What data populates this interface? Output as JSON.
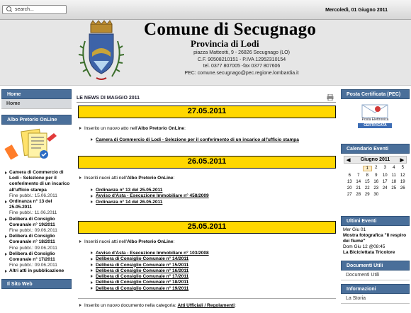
{
  "topbar": {
    "search_placeholder": "search...",
    "date": "Mercoledì, 01 Giugno 2011"
  },
  "header": {
    "title": "Comune di Secugnago",
    "subtitle": "Provincia di Lodi",
    "address": "piazza Matteotti, 9 - 26826 Secugnago (LO)",
    "fiscal": "C.F. 90508210151 - P.IVA 12952310154",
    "phone": "tel. 0377 807005  -fax 0377 807606",
    "pec": "PEC: comune.secugnago@pec.regione.lombardia.it"
  },
  "left": {
    "home_header": "Home",
    "home_item": "Home",
    "albo_header": "Albo Pretorio OnLine",
    "albo_items": [
      {
        "title": "Camera di Commercio di Lodi - Selezione per il conferimento di un incarico all'ufficio stampa",
        "date": "Fine pubbl.: 15.06.2011"
      },
      {
        "title": "Ordinanza n° 13 del 25.05.2011",
        "date": "Fine pubbl.: 11.06.2011"
      },
      {
        "title": "Delibera di Consiglio Comunale n° 19/2011",
        "date": "Fine pubbl.: 09.06.2011"
      },
      {
        "title": "Delibera di Consiglio Comunale n° 18/2011",
        "date": "Fine pubbl.: 09.06.2011"
      },
      {
        "title": "Delibera di Consiglio Comunale n° 17/2011",
        "date": "Fine pubbl.: 09.06.2011"
      },
      {
        "title": "Altri atti in pubblicazione",
        "date": ""
      }
    ],
    "sito_header": "Il Sito Web"
  },
  "main": {
    "title": "LE NEWS DI MAGGIO 2011",
    "days": [
      {
        "date": "27.05.2011",
        "intro_pre": "Inserito un nuovo atto nell'",
        "intro_bold": "Albo Pretorio OnLine",
        "intro_post": ":",
        "links": [
          "Camera di Commercio di Lodi - Selezione per il conferimento di un incarico all'ufficio stampa"
        ]
      },
      {
        "date": "26.05.2011",
        "intro_pre": "Inseriti nuovi atti nell'",
        "intro_bold": "Albo Pretorio OnLine",
        "intro_post": ":",
        "links": [
          "Ordinanza n° 13 del 25.05.2011",
          "Avviso d'Asta - Esecuzione Immobiliare n° 458/2009",
          "Ordinanza n° 14 del 26.05.2011"
        ]
      },
      {
        "date": "25.05.2011",
        "intro_pre": "Inseriti nuovi atti nell'",
        "intro_bold": "Albo Pretorio OnLine",
        "intro_post": ":",
        "links": [
          "Avviso d'Asta - Esecuzione Immobiliare n° 103/2008",
          "Delibera di Consiglio Comunale n° 14/2011",
          "Delibera di Consiglio Comunale n° 15/2011",
          "Delibera di Consiglio Comunale n° 16/2011",
          "Delibera di Consiglio Comunale n° 17/2011",
          "Delibera di Consiglio Comunale n° 18/2011",
          "Delibera di Consiglio Comunale n° 19/2011"
        ]
      }
    ],
    "last_entry_pre": "Inserito un nuovo documento nella categoria: ",
    "last_entry_link": "Atti Ufficiali / Regolamenti",
    "last_entry_post": ":"
  },
  "right": {
    "pec_header": "Posta Certificata (PEC)",
    "pec_badge_top": "Posta Elettronica",
    "pec_badge_bottom": "CERTIFICATA",
    "cal_header": "Calendario Eventi",
    "cal_month": "Giugno 2011",
    "cal_days": [
      "",
      "",
      "1",
      "2",
      "3",
      "4",
      "5",
      "6",
      "7",
      "8",
      "9",
      "10",
      "11",
      "12",
      "13",
      "14",
      "15",
      "16",
      "17",
      "18",
      "19",
      "20",
      "21",
      "22",
      "23",
      "24",
      "25",
      "26",
      "27",
      "28",
      "29",
      "30"
    ],
    "events_header": "Ultimi Eventi",
    "events": [
      {
        "when": "Mer Giu 01",
        "what": "Mostra fotografica \"Il respiro dei fiume\""
      },
      {
        "when": "Dom Giu 12 @08:45",
        "what": "La Biciclettata Tricolore"
      }
    ],
    "docs_header": "Documenti Utili",
    "docs_item": "Documenti Utili",
    "info_header": "Informazioni",
    "info_item": "La Storia"
  },
  "colors": {
    "menu_header": "#4a6f9a",
    "day_bar": "#ffd700"
  }
}
